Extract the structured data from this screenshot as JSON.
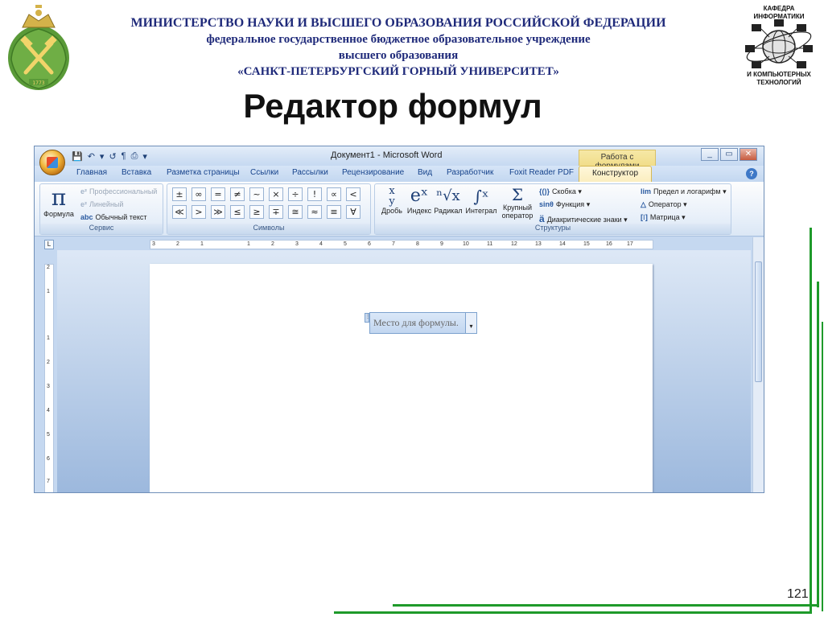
{
  "header": {
    "line1": "МИНИСТЕРСТВО НАУКИ И ВЫСШЕГО ОБРАЗОВАНИЯ РОССИЙСКОЙ ФЕДЕРАЦИИ",
    "line2": "федеральное государственное бюджетное образовательное учреждение",
    "line3": "высшего образования",
    "line4": "«САНКТ-ПЕТЕРБУРГСКИЙ ГОРНЫЙ УНИВЕРСИТЕТ»",
    "logo_year": "1773",
    "kafedra_top": "КАФЕДРА ИНФОРМАТИКИ",
    "kafedra_bottom": "И КОМПЬЮТЕРНЫХ ТЕХНОЛОГИЙ"
  },
  "slide": {
    "title": "Редактор формул",
    "page_number": "121"
  },
  "word": {
    "window_title": "Документ1 - Microsoft Word",
    "context_tool": "Работа с формулами",
    "tabs": [
      "Главная",
      "Вставка",
      "Разметка страницы",
      "Ссылки",
      "Рассылки",
      "Рецензирование",
      "Вид",
      "Разработчик",
      "Foxit Reader PDF",
      "Конструктор"
    ],
    "service": {
      "formula_label": "Формула",
      "professional": "Профессиональный",
      "linear": "Линейный",
      "plain_text": "Обычный текст",
      "group_label": "Сервис"
    },
    "symbols": {
      "row1": [
        "±",
        "∞",
        "=",
        "≠",
        "~",
        "×",
        "÷",
        "!",
        "∝",
        "<"
      ],
      "row2": [
        "≪",
        ">",
        "≫",
        "≤",
        "≥",
        "∓",
        "≅",
        "≈",
        "≡",
        "∀"
      ],
      "group_label": "Символы"
    },
    "structures": {
      "fraction": "Дробь",
      "index": "Индекс",
      "radical": "Радикал",
      "integral": "Интеграл",
      "large_operator_1": "Крупный",
      "large_operator_2": "оператор",
      "bracket": "Скобка",
      "function": "Функция",
      "accent": "Диакритические знаки",
      "limit": "Предел и логарифм",
      "operator": "Оператор",
      "matrix": "Матрица",
      "group_label": "Структуры"
    },
    "ruler_h": [
      "3",
      "2",
      "1",
      "1",
      "2",
      "3",
      "4",
      "5",
      "6",
      "7",
      "8",
      "9",
      "10",
      "11",
      "12",
      "13",
      "14",
      "15",
      "16",
      "17"
    ],
    "ruler_v": [
      "2",
      "1",
      "1",
      "2",
      "3",
      "4",
      "5",
      "6",
      "7"
    ],
    "formula_placeholder": "Место для формулы."
  }
}
